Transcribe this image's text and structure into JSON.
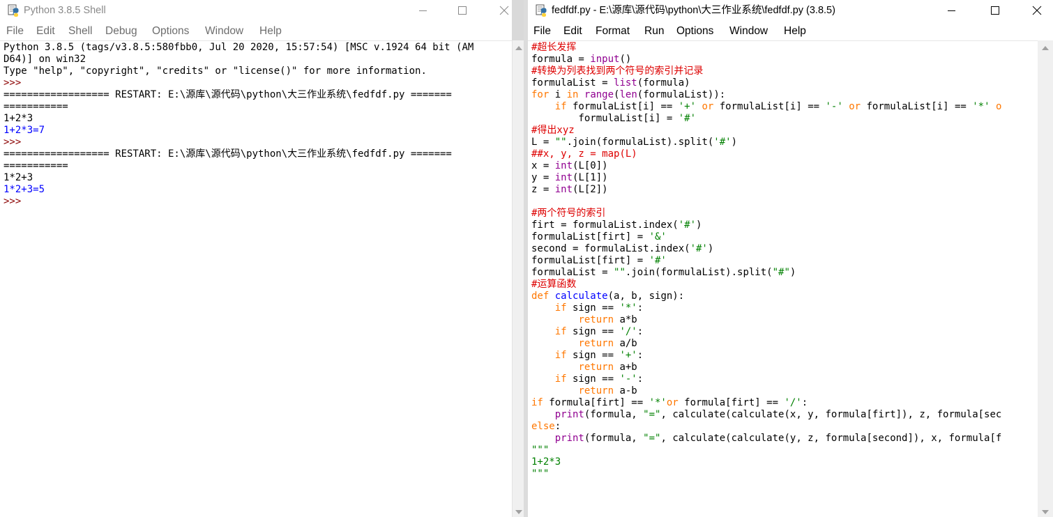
{
  "shell": {
    "title": "Python 3.8.5 Shell",
    "menu": [
      "File",
      "Edit",
      "Shell",
      "Debug",
      "Options",
      "Window",
      "Help"
    ],
    "lines": [
      {
        "cls": "",
        "text": "Python 3.8.5 (tags/v3.8.5:580fbb0, Jul 20 2020, 15:57:54) [MSC v.1924 64 bit (AM"
      },
      {
        "cls": "",
        "text": "D64)] on win32"
      },
      {
        "cls": "",
        "text": "Type \"help\", \"copyright\", \"credits\" or \"license()\" for more information."
      },
      {
        "cls": "c-prompt",
        "text": ">>> "
      },
      {
        "cls": "",
        "text": "================== RESTART: E:\\源库\\源代码\\python\\大三作业系统\\fedfdf.py ======="
      },
      {
        "cls": "",
        "text": "==========="
      },
      {
        "cls": "",
        "text": "1+2*3"
      },
      {
        "cls": "c-out",
        "text": "1+2*3=7"
      },
      {
        "cls": "c-prompt",
        "text": ">>> "
      },
      {
        "cls": "",
        "text": "================== RESTART: E:\\源库\\源代码\\python\\大三作业系统\\fedfdf.py ======="
      },
      {
        "cls": "",
        "text": "==========="
      },
      {
        "cls": "",
        "text": "1*2+3"
      },
      {
        "cls": "c-out",
        "text": "1*2+3=5"
      },
      {
        "cls": "c-prompt",
        "text": ">>> "
      }
    ]
  },
  "editor": {
    "title": "fedfdf.py - E:\\源库\\源代码\\python\\大三作业系统\\fedfdf.py (3.8.5)",
    "menu": [
      "File",
      "Edit",
      "Format",
      "Run",
      "Options",
      "Window",
      "Help"
    ],
    "lines": [
      [
        {
          "c": "c-cmt",
          "t": "#超长发挥"
        }
      ],
      [
        {
          "c": "",
          "t": "formula = "
        },
        {
          "c": "c-bi",
          "t": "input"
        },
        {
          "c": "",
          "t": "()"
        }
      ],
      [
        {
          "c": "c-cmt",
          "t": "#转换为列表找到两个符号的索引并记录"
        }
      ],
      [
        {
          "c": "",
          "t": "formulaList = "
        },
        {
          "c": "c-bi",
          "t": "list"
        },
        {
          "c": "",
          "t": "(formula)"
        }
      ],
      [
        {
          "c": "c-kw",
          "t": "for"
        },
        {
          "c": "",
          "t": " i "
        },
        {
          "c": "c-kw",
          "t": "in"
        },
        {
          "c": "",
          "t": " "
        },
        {
          "c": "c-bi",
          "t": "range"
        },
        {
          "c": "",
          "t": "("
        },
        {
          "c": "c-bi",
          "t": "len"
        },
        {
          "c": "",
          "t": "(formulaList)):"
        }
      ],
      [
        {
          "c": "",
          "t": "    "
        },
        {
          "c": "c-kw",
          "t": "if"
        },
        {
          "c": "",
          "t": " formulaList[i] == "
        },
        {
          "c": "c-str",
          "t": "'+'"
        },
        {
          "c": "",
          "t": " "
        },
        {
          "c": "c-kw",
          "t": "or"
        },
        {
          "c": "",
          "t": " formulaList[i] == "
        },
        {
          "c": "c-str",
          "t": "'-'"
        },
        {
          "c": "",
          "t": " "
        },
        {
          "c": "c-kw",
          "t": "or"
        },
        {
          "c": "",
          "t": " formulaList[i] == "
        },
        {
          "c": "c-str",
          "t": "'*'"
        },
        {
          "c": "",
          "t": " "
        },
        {
          "c": "c-kw",
          "t": "o"
        }
      ],
      [
        {
          "c": "",
          "t": "        formulaList[i] = "
        },
        {
          "c": "c-str",
          "t": "'#'"
        }
      ],
      [
        {
          "c": "c-cmt",
          "t": "#得出xyz"
        }
      ],
      [
        {
          "c": "",
          "t": "L = "
        },
        {
          "c": "c-str",
          "t": "\"\""
        },
        {
          "c": "",
          "t": ".join(formulaList).split("
        },
        {
          "c": "c-str",
          "t": "'#'"
        },
        {
          "c": "",
          "t": ")"
        }
      ],
      [
        {
          "c": "c-cmt",
          "t": "##x, y, z = map(L)"
        }
      ],
      [
        {
          "c": "",
          "t": "x = "
        },
        {
          "c": "c-bi",
          "t": "int"
        },
        {
          "c": "",
          "t": "(L[0])"
        }
      ],
      [
        {
          "c": "",
          "t": "y = "
        },
        {
          "c": "c-bi",
          "t": "int"
        },
        {
          "c": "",
          "t": "(L[1])"
        }
      ],
      [
        {
          "c": "",
          "t": "z = "
        },
        {
          "c": "c-bi",
          "t": "int"
        },
        {
          "c": "",
          "t": "(L[2])"
        }
      ],
      [
        {
          "c": "",
          "t": ""
        }
      ],
      [
        {
          "c": "c-cmt",
          "t": "#两个符号的索引"
        }
      ],
      [
        {
          "c": "",
          "t": "firt = formulaList.index("
        },
        {
          "c": "c-str",
          "t": "'#'"
        },
        {
          "c": "",
          "t": ")"
        }
      ],
      [
        {
          "c": "",
          "t": "formulaList[firt] = "
        },
        {
          "c": "c-str",
          "t": "'&'"
        }
      ],
      [
        {
          "c": "",
          "t": "second = formulaList.index("
        },
        {
          "c": "c-str",
          "t": "'#'"
        },
        {
          "c": "",
          "t": ")"
        }
      ],
      [
        {
          "c": "",
          "t": "formulaList[firt] = "
        },
        {
          "c": "c-str",
          "t": "'#'"
        }
      ],
      [
        {
          "c": "",
          "t": "formulaList = "
        },
        {
          "c": "c-str",
          "t": "\"\""
        },
        {
          "c": "",
          "t": ".join(formulaList).split("
        },
        {
          "c": "c-str",
          "t": "\"#\""
        },
        {
          "c": "",
          "t": ")"
        }
      ],
      [
        {
          "c": "c-cmt",
          "t": "#运算函数"
        }
      ],
      [
        {
          "c": "c-kw",
          "t": "def"
        },
        {
          "c": "",
          "t": " "
        },
        {
          "c": "c-def",
          "t": "calculate"
        },
        {
          "c": "",
          "t": "(a, b, sign):"
        }
      ],
      [
        {
          "c": "",
          "t": "    "
        },
        {
          "c": "c-kw",
          "t": "if"
        },
        {
          "c": "",
          "t": " sign == "
        },
        {
          "c": "c-str",
          "t": "'*'"
        },
        {
          "c": "",
          "t": ":"
        }
      ],
      [
        {
          "c": "",
          "t": "        "
        },
        {
          "c": "c-kw",
          "t": "return"
        },
        {
          "c": "",
          "t": " a*b"
        }
      ],
      [
        {
          "c": "",
          "t": "    "
        },
        {
          "c": "c-kw",
          "t": "if"
        },
        {
          "c": "",
          "t": " sign == "
        },
        {
          "c": "c-str",
          "t": "'/'"
        },
        {
          "c": "",
          "t": ":"
        }
      ],
      [
        {
          "c": "",
          "t": "        "
        },
        {
          "c": "c-kw",
          "t": "return"
        },
        {
          "c": "",
          "t": " a/b"
        }
      ],
      [
        {
          "c": "",
          "t": "    "
        },
        {
          "c": "c-kw",
          "t": "if"
        },
        {
          "c": "",
          "t": " sign == "
        },
        {
          "c": "c-str",
          "t": "'+'"
        },
        {
          "c": "",
          "t": ":"
        }
      ],
      [
        {
          "c": "",
          "t": "        "
        },
        {
          "c": "c-kw",
          "t": "return"
        },
        {
          "c": "",
          "t": " a+b"
        }
      ],
      [
        {
          "c": "",
          "t": "    "
        },
        {
          "c": "c-kw",
          "t": "if"
        },
        {
          "c": "",
          "t": " sign == "
        },
        {
          "c": "c-str",
          "t": "'-'"
        },
        {
          "c": "",
          "t": ":"
        }
      ],
      [
        {
          "c": "",
          "t": "        "
        },
        {
          "c": "c-kw",
          "t": "return"
        },
        {
          "c": "",
          "t": " a-b"
        }
      ],
      [
        {
          "c": "c-kw",
          "t": "if"
        },
        {
          "c": "",
          "t": " formula[firt] == "
        },
        {
          "c": "c-str",
          "t": "'*'"
        },
        {
          "c": "c-kw",
          "t": "or"
        },
        {
          "c": "",
          "t": " formula[firt] == "
        },
        {
          "c": "c-str",
          "t": "'/'"
        },
        {
          "c": "",
          "t": ":"
        }
      ],
      [
        {
          "c": "",
          "t": "    "
        },
        {
          "c": "c-bi",
          "t": "print"
        },
        {
          "c": "",
          "t": "(formula, "
        },
        {
          "c": "c-str",
          "t": "\"=\""
        },
        {
          "c": "",
          "t": ", calculate(calculate(x, y, formula[firt]), z, formula[sec"
        }
      ],
      [
        {
          "c": "c-kw",
          "t": "else"
        },
        {
          "c": "",
          "t": ":"
        }
      ],
      [
        {
          "c": "",
          "t": "    "
        },
        {
          "c": "c-bi",
          "t": "print"
        },
        {
          "c": "",
          "t": "(formula, "
        },
        {
          "c": "c-str",
          "t": "\"=\""
        },
        {
          "c": "",
          "t": ", calculate(calculate(y, z, formula[second]), x, formula[f"
        }
      ],
      [
        {
          "c": "c-str",
          "t": "\"\"\""
        }
      ],
      [
        {
          "c": "c-str",
          "t": "1+2*3"
        }
      ],
      [
        {
          "c": "c-str",
          "t": "\"\"\""
        }
      ]
    ]
  },
  "colors": {
    "comment": "#dd0000",
    "string": "#008000",
    "keyword": "#ff7700",
    "builtin": "#900090",
    "definition": "#0000ff",
    "output": "#0000ff"
  }
}
